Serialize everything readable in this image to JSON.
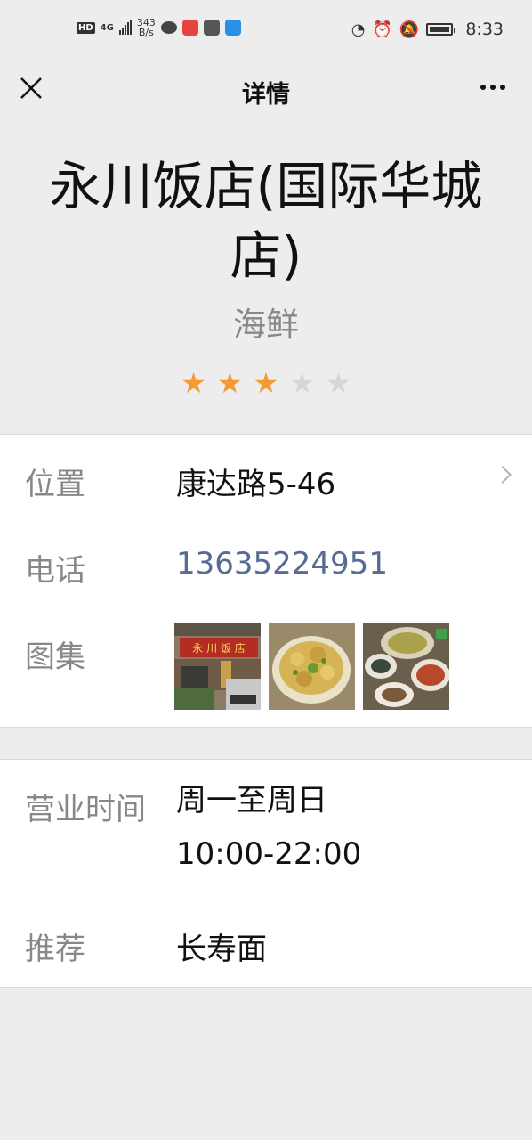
{
  "status_bar": {
    "hd": "HD",
    "network": "4G",
    "speed_value": "343",
    "speed_unit": "B/s",
    "time": "8:33"
  },
  "nav": {
    "title": "详情",
    "close_icon": "close-icon",
    "more_icon": "more-icon"
  },
  "shop": {
    "name": "永川饭店(国际华城店)",
    "category": "海鲜",
    "rating": 3,
    "rating_max": 5,
    "star_on_color": "#f59a33",
    "star_off_color": "#d6d6d6"
  },
  "info": {
    "location_label": "位置",
    "location_value": "康达路5-46",
    "phone_label": "电话",
    "phone_value": "13635224951",
    "gallery_label": "图集",
    "gallery": [
      "storefront-photo",
      "fried-dish-photo",
      "table-dishes-photo"
    ]
  },
  "extra": {
    "hours_label": "营业时间",
    "hours_days": "周一至周日",
    "hours_time": "10:00-22:00",
    "recommend_label": "推荐",
    "recommend_value": "长寿面"
  },
  "colors": {
    "background": "#ededed",
    "link": "#576b95"
  }
}
